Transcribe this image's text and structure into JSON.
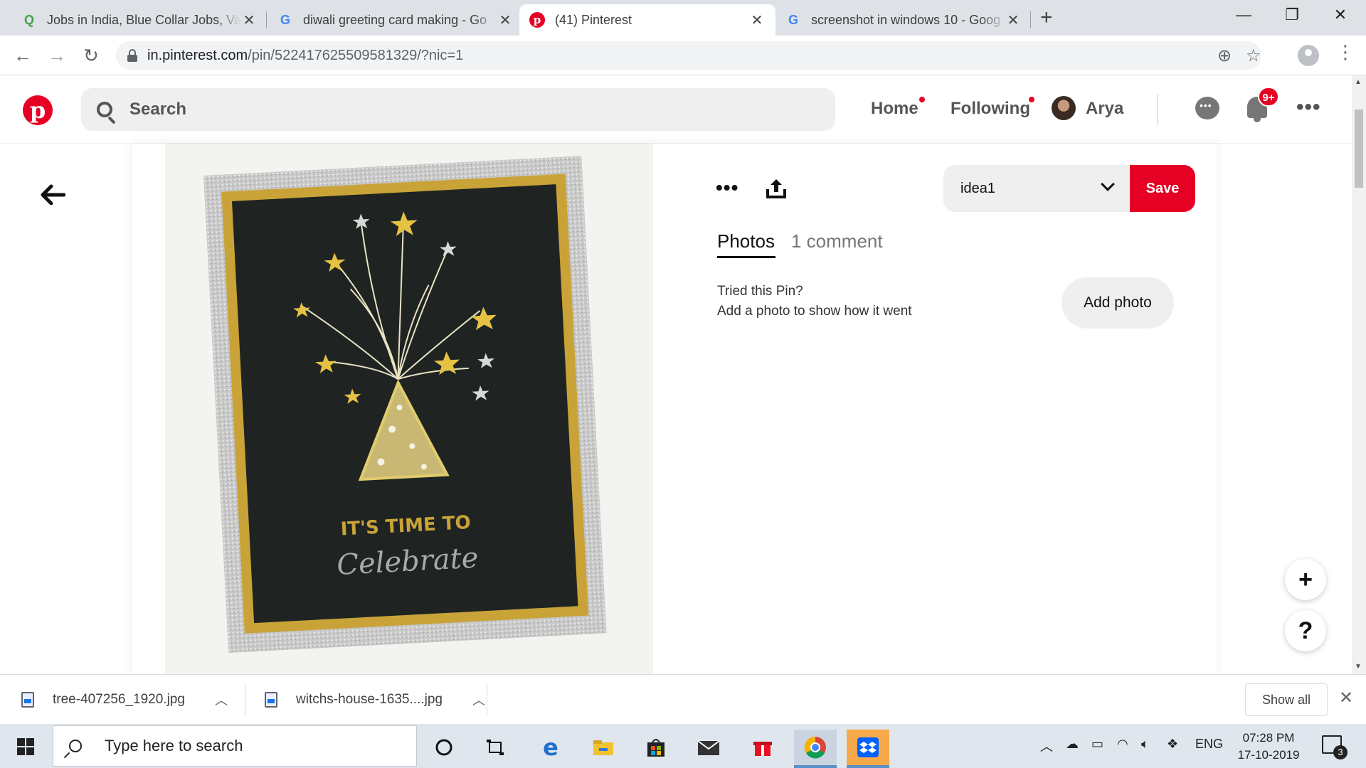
{
  "browser": {
    "tabs": [
      {
        "title": "Jobs in India, Blue Collar Jobs, Va",
        "favicon": "quikr-q-icon",
        "favicon_color": "#4caf50"
      },
      {
        "title": "diwali greeting card making - Go",
        "favicon": "google-g-icon",
        "favicon_color": "#4285f4"
      },
      {
        "title": "(41) Pinterest",
        "favicon": "pinterest-icon",
        "favicon_color": "#e60023"
      },
      {
        "title": "screenshot in windows 10 - Goog",
        "favicon": "google-g-icon",
        "favicon_color": "#4285f4"
      }
    ],
    "active_tab": 2,
    "url_host": "in.pinterest.com",
    "url_path": "/pin/522417625509581329/?nic=1"
  },
  "pinterest": {
    "search_placeholder": "Search",
    "nav": {
      "home": "Home",
      "following": "Following",
      "user": "Arya"
    },
    "notification_badge": "9+",
    "brand_color": "#e60023",
    "board_name": "idea1",
    "save_label": "Save",
    "tabs": {
      "photos": "Photos",
      "comments": "1 comment"
    },
    "tried_title": "Tried this Pin?",
    "tried_subtitle": "Add a photo to show how it went",
    "add_photo_label": "Add photo",
    "fab_add": "+",
    "fab_help": "?",
    "pin_image_text": {
      "line1": "IT'S TIME TO",
      "line2": "Celebrate"
    }
  },
  "downloads": {
    "items": [
      {
        "name": "tree-407256_1920.jpg"
      },
      {
        "name": "witchs-house-1635....jpg"
      }
    ],
    "show_all": "Show all"
  },
  "taskbar": {
    "search_placeholder": "Type here to search",
    "language": "ENG",
    "time": "07:28 PM",
    "date": "17-10-2019",
    "notification_count": "3"
  }
}
